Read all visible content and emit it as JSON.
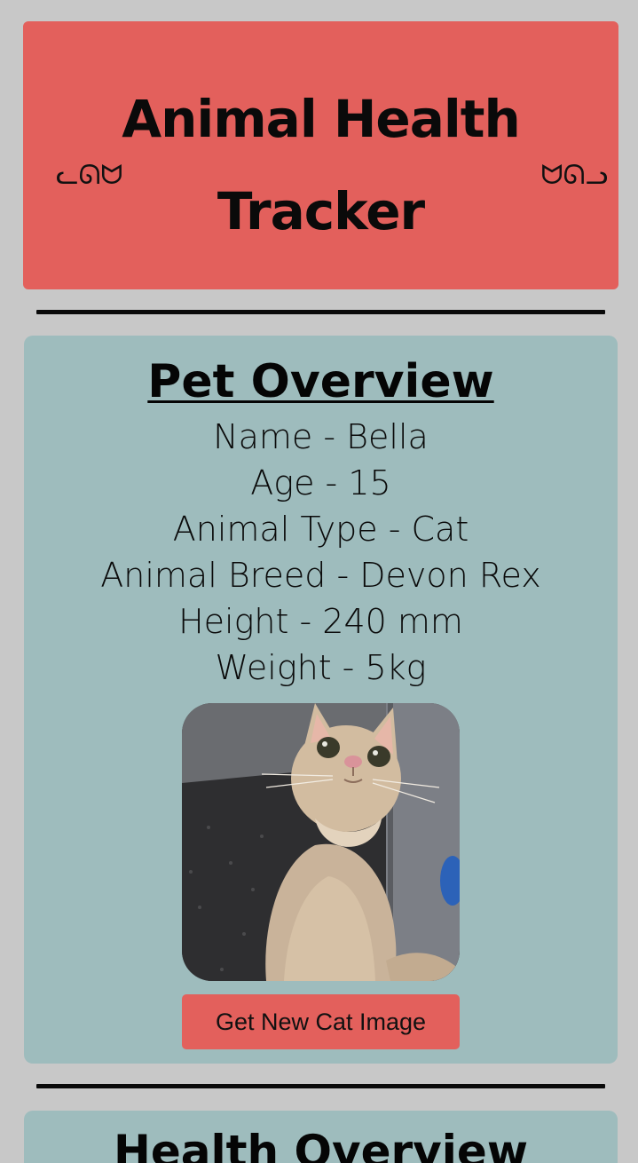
{
  "header": {
    "title": "Animal Health Tracker",
    "decoration_left": "ᓚᘏᗢ",
    "decoration_right": "ᗢᘏᓗ",
    "background_color": "#e3605c"
  },
  "pet_overview": {
    "title": "Pet Overview",
    "details": [
      "Name - Bella",
      "Age - 15",
      "Animal Type - Cat",
      "Animal Breed - Devon Rex",
      "Height - 240 mm",
      "Weight - 5kg"
    ],
    "photo_icon": "cat-photo",
    "button_label": "Get New Cat Image",
    "background_color": "#9ebcbd"
  },
  "health_overview": {
    "title": "Health Overview"
  }
}
